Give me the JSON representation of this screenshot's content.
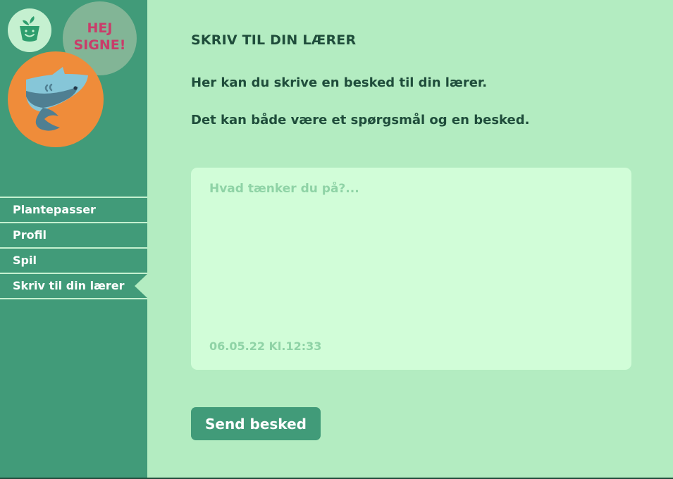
{
  "sidebar": {
    "greeting": "HEJ\nSIGNE!",
    "logo_icon": "plant-pot-icon",
    "avatar_icon": "shark-avatar",
    "items": [
      {
        "label": "Plantepasser"
      },
      {
        "label": "Profil"
      },
      {
        "label": "Spil"
      },
      {
        "label": "Skriv til din lærer",
        "active": true
      }
    ]
  },
  "main": {
    "title": "SKRIV TIL DIN LÆRER",
    "intro1": "Her kan du skrive en besked til din lærer.",
    "intro2": "Det kan både være et spørgsmål og en besked.",
    "message": {
      "placeholder": "Hvad tænker du på?...",
      "value": "",
      "timestamp": "06.05.22 Kl.12:33"
    },
    "send_label": "Send besked"
  },
  "colors": {
    "sidebar_bg": "#419b79",
    "main_bg": "#b3ecc1",
    "card_bg": "#d1fdd8",
    "text_dark": "#1f4d3b",
    "greeting_text": "#c93d6a",
    "avatar_bg": "#ef8c3a"
  }
}
